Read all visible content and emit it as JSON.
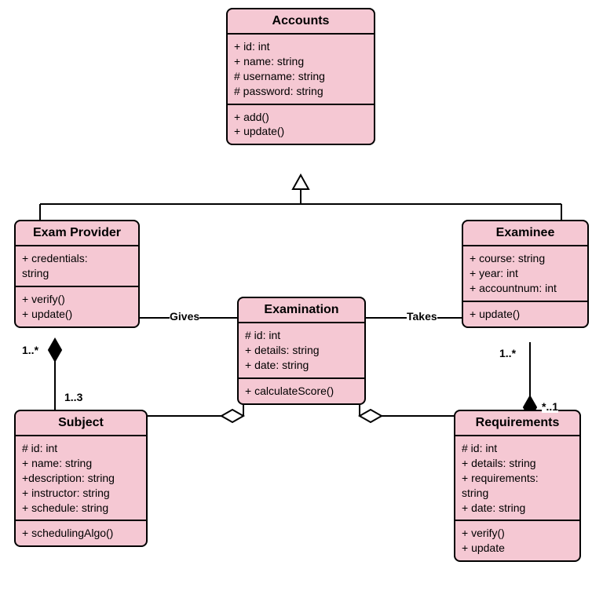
{
  "classes": {
    "accounts": {
      "title": "Accounts",
      "attrs": [
        "+ id: int",
        "+ name: string",
        "# username: string",
        "# password: string"
      ],
      "ops": [
        "+ add()",
        "+ update()"
      ]
    },
    "examProvider": {
      "title": "Exam Provider",
      "attrs": [
        "+ credentials:",
        "string"
      ],
      "ops": [
        "+ verify()",
        "+ update()"
      ]
    },
    "examinee": {
      "title": "Examinee",
      "attrs": [
        "+ course: string",
        "+ year: int",
        "+ accountnum: int"
      ],
      "ops": [
        "+ update()"
      ]
    },
    "examination": {
      "title": "Examination",
      "attrs": [
        "# id: int",
        "+ details: string",
        "+ date: string"
      ],
      "ops": [
        "+ calculateScore()"
      ]
    },
    "subject": {
      "title": "Subject",
      "attrs": [
        "# id: int",
        "+ name: string",
        "+description: string",
        "+ instructor: string",
        "+ schedule: string"
      ],
      "ops": [
        "+ schedulingAlgo()"
      ]
    },
    "requirements": {
      "title": "Requirements",
      "attrs": [
        "# id: int",
        "+ details: string",
        "+ requirements:",
        "string",
        "+ date: string"
      ],
      "ops": [
        "+ verify()",
        "+ update"
      ]
    }
  },
  "labels": {
    "gives": "Gives",
    "takes": "Takes",
    "provSubjTop": "1..*",
    "provSubjBot": "1..3",
    "examineeReqTop": "1..*",
    "examineeReqBot": "*..1"
  }
}
